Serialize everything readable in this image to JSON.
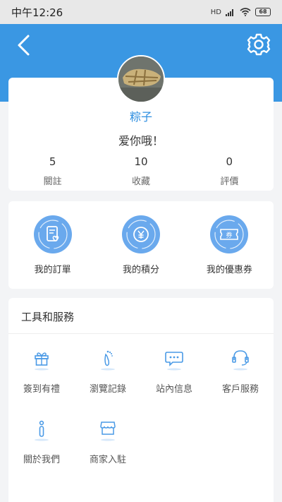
{
  "status_bar": {
    "time": "中午12:26",
    "network": "HD",
    "battery": "68"
  },
  "header": {
    "back_icon": "chevron-left-icon",
    "settings_icon": "gear-icon"
  },
  "profile": {
    "name": "粽子",
    "motto": "爱你哦！",
    "stats": [
      {
        "value": "5",
        "label": "關註"
      },
      {
        "value": "10",
        "label": "收藏"
      },
      {
        "value": "0",
        "label": "評價"
      }
    ]
  },
  "quick_links": [
    {
      "label": "我的訂單",
      "icon": "order-icon"
    },
    {
      "label": "我的積分",
      "icon": "points-icon"
    },
    {
      "label": "我的優惠券",
      "icon": "coupon-icon",
      "icon_text": "券"
    }
  ],
  "services": {
    "title": "工具和服務",
    "items": [
      {
        "label": "簽到有禮",
        "icon": "gift-icon"
      },
      {
        "label": "瀏覽記錄",
        "icon": "footprint-icon"
      },
      {
        "label": "站內信息",
        "icon": "message-icon"
      },
      {
        "label": "客戶服務",
        "icon": "headset-icon"
      },
      {
        "label": "關於我們",
        "icon": "info-icon"
      },
      {
        "label": "商家入駐",
        "icon": "store-icon"
      }
    ]
  },
  "colors": {
    "primary": "#3a97e3",
    "icon_circle": "#6aa9ed",
    "name_text": "#2f8fe0",
    "service_icon": "#4a9ae6"
  }
}
